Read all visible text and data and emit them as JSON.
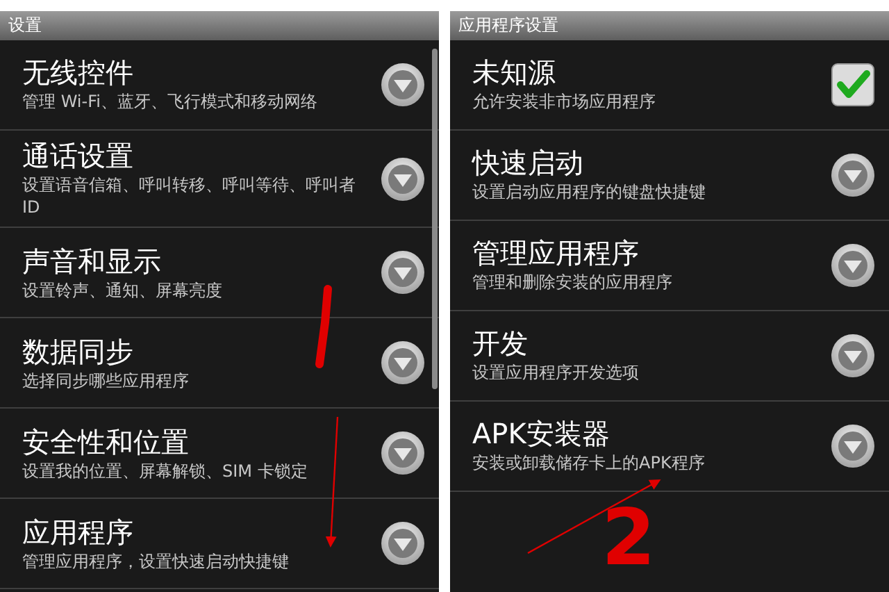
{
  "panels": [
    {
      "title": "设置",
      "scrollable": true,
      "items": [
        {
          "kind": "menu",
          "title": "无线控件",
          "summary": "管理 Wi-Fi、蓝牙、飞行模式和移动网络"
        },
        {
          "kind": "menu",
          "title": "通话设置",
          "summary": "设置语音信箱、呼叫转移、呼叫等待、呼叫者 ID"
        },
        {
          "kind": "menu",
          "title": "声音和显示",
          "summary": "设置铃声、通知、屏幕亮度"
        },
        {
          "kind": "menu",
          "title": "数据同步",
          "summary": "选择同步哪些应用程序"
        },
        {
          "kind": "menu",
          "title": "安全性和位置",
          "summary": "设置我的位置、屏幕解锁、SIM 卡锁定"
        },
        {
          "kind": "menu",
          "title": "应用程序",
          "summary": "管理应用程序，设置快速启动快捷键"
        }
      ]
    },
    {
      "title": "应用程序设置",
      "scrollable": false,
      "items": [
        {
          "kind": "checkbox",
          "title": "未知源",
          "summary": "允许安装非市场应用程序",
          "checked": true
        },
        {
          "kind": "menu",
          "title": "快速启动",
          "summary": "设置启动应用程序的键盘快捷键"
        },
        {
          "kind": "menu",
          "title": "管理应用程序",
          "summary": "管理和删除安装的应用程序"
        },
        {
          "kind": "menu",
          "title": "开发",
          "summary": "设置应用程序开发选项"
        },
        {
          "kind": "menu",
          "title": "APK安装器",
          "summary": "安装或卸载储存卡上的APK程序"
        }
      ]
    }
  ],
  "annotations": [
    {
      "kind": "stroke"
    },
    {
      "kind": "arrow"
    },
    {
      "kind": "number",
      "text": "2"
    },
    {
      "kind": "arrow"
    }
  ]
}
